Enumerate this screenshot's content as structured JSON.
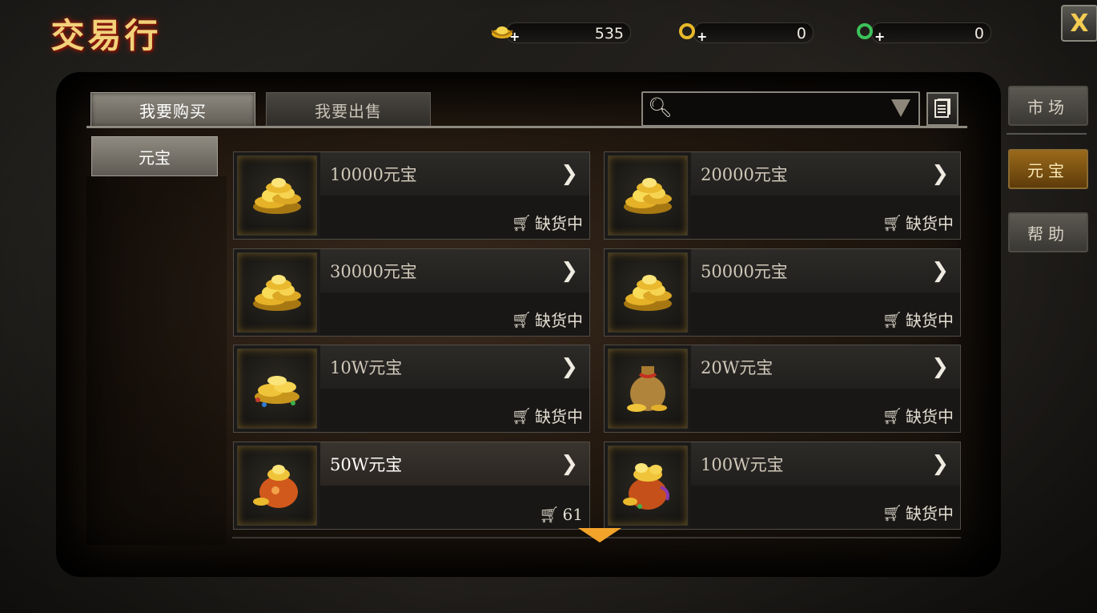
{
  "window": {
    "title": "交易行",
    "close_label": "X"
  },
  "currencies": [
    {
      "icon": "gold-ingot-icon",
      "value": "535"
    },
    {
      "icon": "gold-ring-icon",
      "value": "0"
    },
    {
      "icon": "jade-ring-icon",
      "value": "0"
    }
  ],
  "tabs": {
    "buy": "我要购买",
    "sell": "我要出售"
  },
  "search": {
    "placeholder": ""
  },
  "category": {
    "label": "元宝"
  },
  "items": [
    {
      "name": "10000元宝",
      "stock": "缺货中",
      "icon": "gold-ingot-pile-icon"
    },
    {
      "name": "20000元宝",
      "stock": "缺货中",
      "icon": "gold-ingot-pile-icon"
    },
    {
      "name": "30000元宝",
      "stock": "缺货中",
      "icon": "gold-ingot-pile-icon"
    },
    {
      "name": "50000元宝",
      "stock": "缺货中",
      "icon": "gold-ingot-pile-icon"
    },
    {
      "name": "10W元宝",
      "stock": "缺货中",
      "icon": "gold-ingot-jewels-icon"
    },
    {
      "name": "20W元宝",
      "stock": "缺货中",
      "icon": "money-bag-icon"
    },
    {
      "name": "50W元宝",
      "stock": "61",
      "icon": "red-money-bag-icon"
    },
    {
      "name": "100W元宝",
      "stock": "缺货中",
      "icon": "treasure-bag-icon"
    }
  ],
  "side": {
    "market": "市场",
    "yuanbao": "元宝",
    "help": "帮助"
  },
  "colors": {
    "accent_gold": "#f2a42a",
    "active_side": "#9a6a1a"
  }
}
